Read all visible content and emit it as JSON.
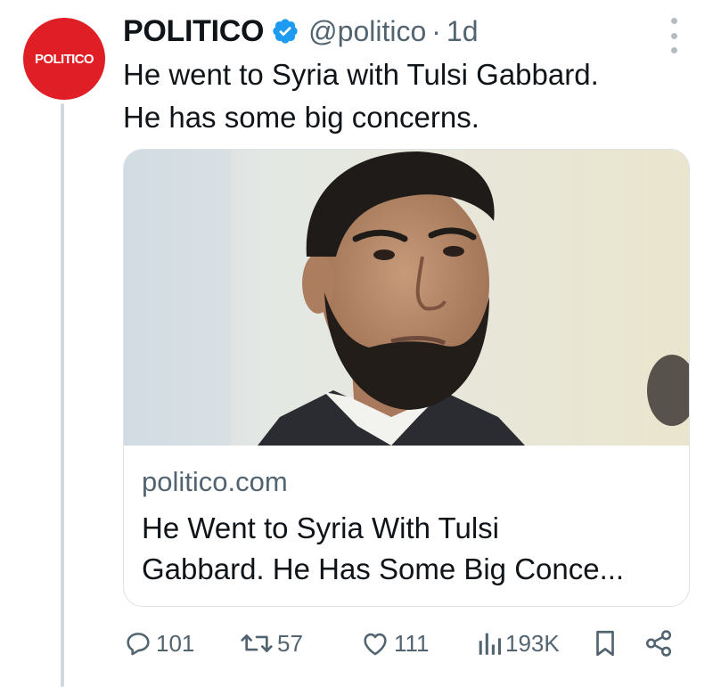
{
  "tweet": {
    "avatar_text": "POLITICO",
    "display_name": "POLITICO",
    "handle": "@politico",
    "separator": "·",
    "time": "1d",
    "text_lines": [
      "He went to Syria with Tulsi Gabbard.",
      "He has some big concerns."
    ]
  },
  "card": {
    "domain": "politico.com",
    "title_lines": [
      "He Went to Syria With Tulsi",
      "Gabbard. He Has Some Big Conce..."
    ]
  },
  "actions": {
    "replies": "101",
    "reposts": "57",
    "likes": "111",
    "views": "193K"
  },
  "colors": {
    "brand": "#e01e26",
    "verified": "#1d9bf0",
    "secondary_text": "#536471",
    "primary_text": "#0f1419",
    "thread_line": "#cfd9de"
  },
  "icons": [
    "verified-badge-icon",
    "more-options-icon",
    "reply-icon",
    "repost-icon",
    "like-icon",
    "views-icon",
    "bookmark-icon",
    "share-icon"
  ]
}
